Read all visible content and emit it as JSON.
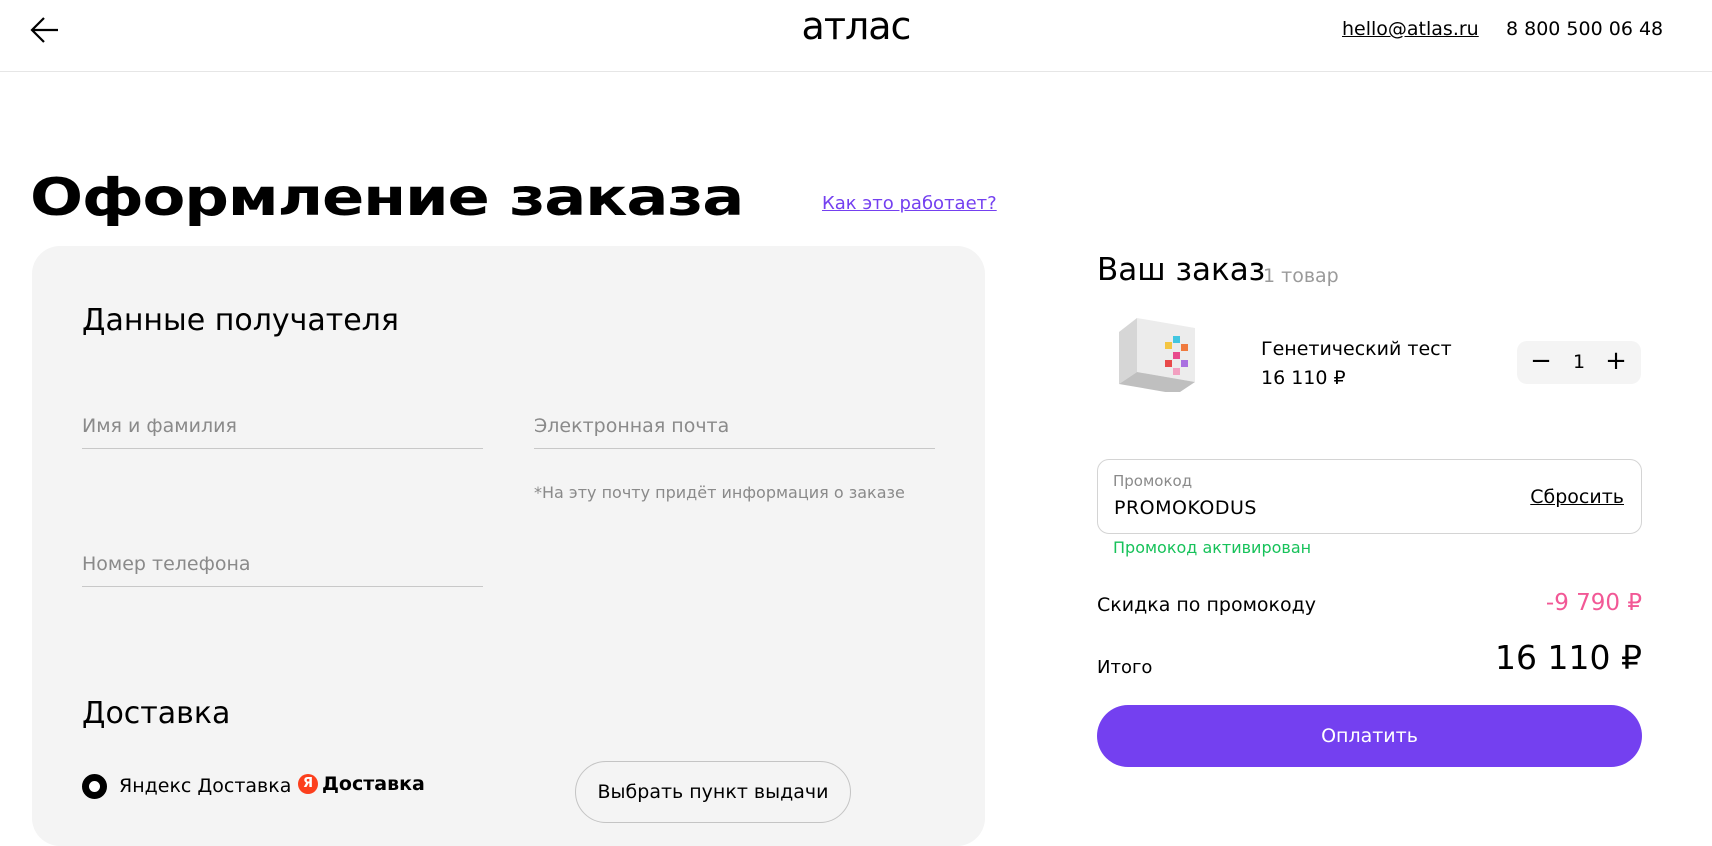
{
  "header": {
    "logo": "атлас",
    "email": "hello@atlas.ru",
    "phone": "8 800 500 06 48"
  },
  "page": {
    "title": "Оформление заказа",
    "how_it_works": "Как это работает?"
  },
  "recipient": {
    "title": "Данные получателя",
    "name_placeholder": "Имя и фамилия",
    "email_placeholder": "Электронная почта",
    "email_hint": "*На эту почту придёт информация о заказе",
    "phone_placeholder": "Номер телефона"
  },
  "delivery": {
    "title": "Доставка",
    "option_label": "Яндекс Доставка",
    "brand_badge": "Я",
    "brand_text": "Доставка",
    "pickup_button": "Выбрать пункт выдачи"
  },
  "order": {
    "title": "Ваш заказ",
    "count": "1 товар",
    "product": {
      "name": "Генетический тест",
      "price": "16 110 ₽",
      "quantity": "1"
    },
    "promo": {
      "label": "Промокод",
      "value": "PROMOKODUS",
      "reset": "Сбросить",
      "status": "Промокод активирован"
    },
    "discount_label": "Скидка по промокоду",
    "discount_value": "-9 790 ₽",
    "total_label": "Итого",
    "total_value": "16 110 ₽",
    "pay_button": "Оплатить"
  },
  "colors": {
    "accent": "#7440f0",
    "success": "#17c25a",
    "discount": "#f25896",
    "panel": "#f4f4f4"
  }
}
